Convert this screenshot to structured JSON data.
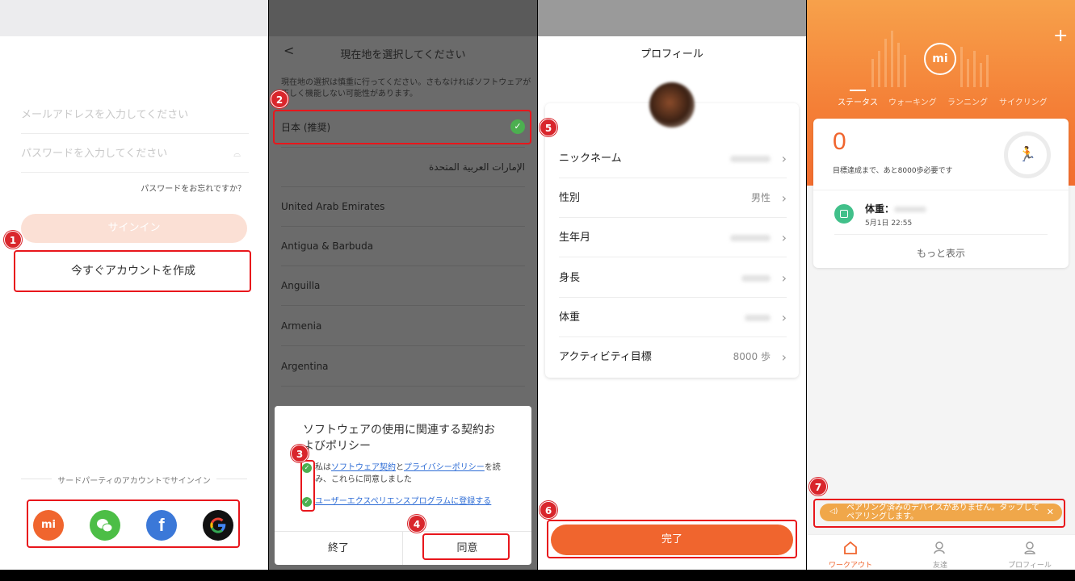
{
  "screen1": {
    "email_placeholder": "メールアドレスを入力してください",
    "password_placeholder": "パスワードを入力してください",
    "forgot_password": "パスワードをお忘れですか？",
    "signin_label": "サインイン",
    "create_account_label": "今すぐアカウントを作成",
    "third_party_label": "サードパーティのアカウントでサインイン",
    "badge": "1",
    "social": [
      "mi-icon",
      "wechat-icon",
      "facebook-icon",
      "google-icon"
    ]
  },
  "screen2": {
    "title": "現在地を選択してください",
    "notice": "現在地の選択は慎重に行ってください。さもなければソフトウェアが正しく機能しない可能性があります。",
    "selected": "日本 (推奨)",
    "countries": [
      "الإمارات العربية المتحدة",
      "United Arab Emirates",
      "Antigua & Barbuda",
      "Anguilla",
      "Armenia",
      "Argentina"
    ],
    "dialog_title": "ソフトウェアの使用に関連する契約およびポリシー",
    "agree1_prefix": "私は",
    "agree1_link1": "ソフトウェア契約",
    "agree1_and": "と",
    "agree1_link2": "プライバシーポリシー",
    "agree1_suffix": "を読み、これらに同意しました",
    "agree2_link": "ユーザーエクスペリエンスプログラムに登録する",
    "exit_label": "終了",
    "agree_label": "同意",
    "badges": [
      "2",
      "3",
      "4"
    ]
  },
  "screen3": {
    "title": "プロフィール",
    "rows": [
      {
        "label": "ニックネーム",
        "value": ""
      },
      {
        "label": "性別",
        "value": "男性"
      },
      {
        "label": "生年月",
        "value": ""
      },
      {
        "label": "身長",
        "value": ""
      },
      {
        "label": "体重",
        "value": ""
      },
      {
        "label": "アクティビティ目標",
        "value": "8000 歩"
      }
    ],
    "done_label": "完了",
    "badges": [
      "5",
      "6"
    ]
  },
  "screen4": {
    "tabs": [
      "ステータス",
      "ウォーキング",
      "ランニング",
      "サイクリング"
    ],
    "steps": "0",
    "goal_text": "目標達成まで、あと8000歩必要です",
    "weight_label": "体重：",
    "weight_date": "5月1日 22:55",
    "more_label": "もっと表示",
    "warning": "ペアリング済みのデバイスがありません。タップしてペアリングします。",
    "nav": [
      "ワークアウト",
      "友達",
      "プロフィール"
    ],
    "badge": "7",
    "plus": "+",
    "logo": "mi"
  },
  "colors": {
    "accent": "#f0652e",
    "highlight": "#e8161c",
    "check": "#4caf50",
    "link": "#2c6bd5"
  }
}
